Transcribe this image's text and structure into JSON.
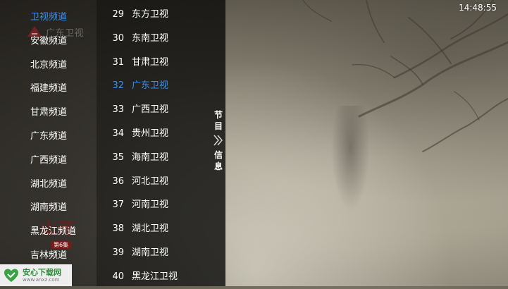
{
  "clock": "14:48:55",
  "channel_logo_text": "广东卫视",
  "episode_title": "山河",
  "episode_num": "第6集",
  "groups": [
    {
      "label": "卫视频道",
      "active": true
    },
    {
      "label": "安徽频道",
      "active": false
    },
    {
      "label": "北京频道",
      "active": false
    },
    {
      "label": "福建频道",
      "active": false
    },
    {
      "label": "甘肃频道",
      "active": false
    },
    {
      "label": "广东频道",
      "active": false
    },
    {
      "label": "广西频道",
      "active": false
    },
    {
      "label": "湖北频道",
      "active": false
    },
    {
      "label": "湖南频道",
      "active": false
    },
    {
      "label": "黑龙江频道",
      "active": false
    },
    {
      "label": "吉林频道",
      "active": false
    }
  ],
  "channels": [
    {
      "num": "29",
      "name": "东方卫视",
      "active": false
    },
    {
      "num": "30",
      "name": "东南卫视",
      "active": false
    },
    {
      "num": "31",
      "name": "甘肃卫视",
      "active": false
    },
    {
      "num": "32",
      "name": "广东卫视",
      "active": true
    },
    {
      "num": "33",
      "name": "广西卫视",
      "active": false
    },
    {
      "num": "34",
      "name": "贵州卫视",
      "active": false
    },
    {
      "num": "35",
      "name": "海南卫视",
      "active": false
    },
    {
      "num": "36",
      "name": "河北卫视",
      "active": false
    },
    {
      "num": "37",
      "name": "河南卫视",
      "active": false
    },
    {
      "num": "38",
      "name": "湖北卫视",
      "active": false
    },
    {
      "num": "39",
      "name": "湖南卫视",
      "active": false
    },
    {
      "num": "40",
      "name": "黑龙江卫视",
      "active": false
    }
  ],
  "info_tab": {
    "char1": "节",
    "char2": "目",
    "char3": "信",
    "char4": "息"
  },
  "watermark": {
    "name": "安心下载网",
    "url": "www.anxz.com"
  },
  "icons": {
    "info_chevron": "double-chevron-right-icon",
    "site": "heart-shield-icon",
    "logo": "channel-logo-icon"
  },
  "colors": {
    "accent": "#3b8ff0",
    "panel": "#141210"
  }
}
